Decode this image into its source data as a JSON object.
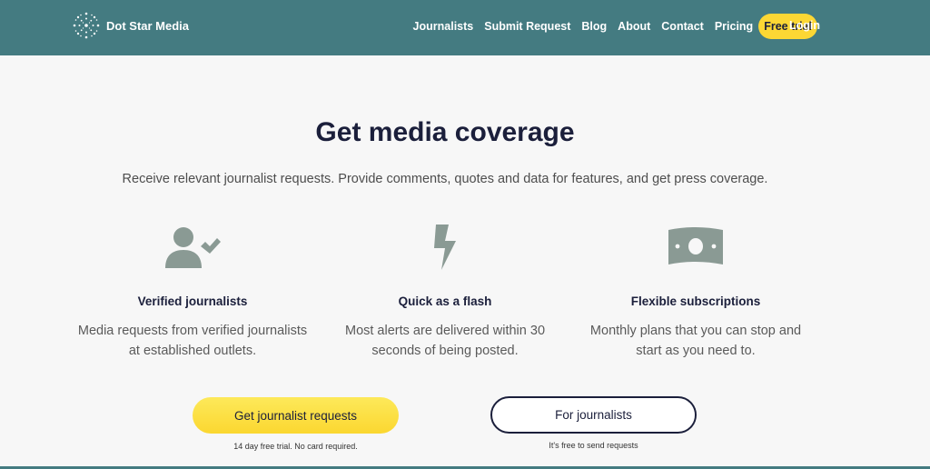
{
  "brand": {
    "name": "Dot Star Media"
  },
  "nav": {
    "links": [
      "Journalists",
      "Submit Request",
      "Blog",
      "About",
      "Contact",
      "Pricing"
    ],
    "free_trial": "Free trial",
    "login": "Login"
  },
  "hero": {
    "title": "Get media coverage",
    "subtitle": "Receive relevant journalist requests. Provide comments, quotes and data for features, and get press coverage."
  },
  "features": [
    {
      "icon": "verified-user-icon",
      "title": "Verified journalists",
      "text": "Media requests from verified journalists at established outlets."
    },
    {
      "icon": "lightning-bolt-icon",
      "title": "Quick as a flash",
      "text": "Most alerts are delivered within 30 seconds of being posted."
    },
    {
      "icon": "money-bill-icon",
      "title": "Flexible subscriptions",
      "text": "Monthly plans that you can stop and start as you need to."
    }
  ],
  "cta": {
    "primary_label": "Get journalist requests",
    "primary_note": "14 day free trial. No card required.",
    "secondary_label": "For journalists",
    "secondary_note": "It's free to send requests"
  },
  "colors": {
    "header": "#447b81",
    "accent": "#fcd734",
    "navy": "#1b1f3b",
    "icon": "#8a9a94"
  }
}
